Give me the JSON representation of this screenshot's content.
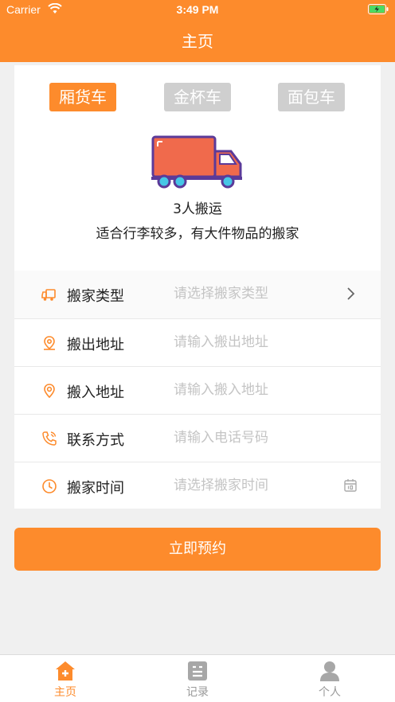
{
  "status_bar": {
    "carrier": "Carrier",
    "time": "3:49 PM"
  },
  "header": {
    "title": "主页"
  },
  "vehicle_tabs": [
    {
      "label": "厢货车",
      "active": true
    },
    {
      "label": "金杯车",
      "active": false
    },
    {
      "label": "面包车",
      "active": false
    }
  ],
  "vehicle_info": {
    "persons": "3人搬运",
    "description": "适合行李较多，有大件物品的搬家"
  },
  "form": {
    "move_type": {
      "label": "搬家类型",
      "placeholder": "请选择搬家类型",
      "icon": "truck-icon"
    },
    "from_address": {
      "label": "搬出地址",
      "placeholder": "请输入搬出地址",
      "icon": "location-pin-icon"
    },
    "to_address": {
      "label": "搬入地址",
      "placeholder": "请输入搬入地址",
      "icon": "location-pin-icon"
    },
    "contact": {
      "label": "联系方式",
      "placeholder": "请输入电话号码",
      "icon": "phone-icon"
    },
    "move_time": {
      "label": "搬家时间",
      "placeholder": "请选择搬家时间",
      "icon": "clock-icon"
    }
  },
  "submit_label": "立即预约",
  "tabbar": [
    {
      "label": "主页",
      "icon": "home-icon",
      "active": true
    },
    {
      "label": "记录",
      "icon": "list-icon",
      "active": false
    },
    {
      "label": "个人",
      "icon": "person-icon",
      "active": false
    }
  ],
  "colors": {
    "accent": "#fd8b2c",
    "inactive_tab": "#cfcfcf",
    "background": "#f0f0f0"
  }
}
